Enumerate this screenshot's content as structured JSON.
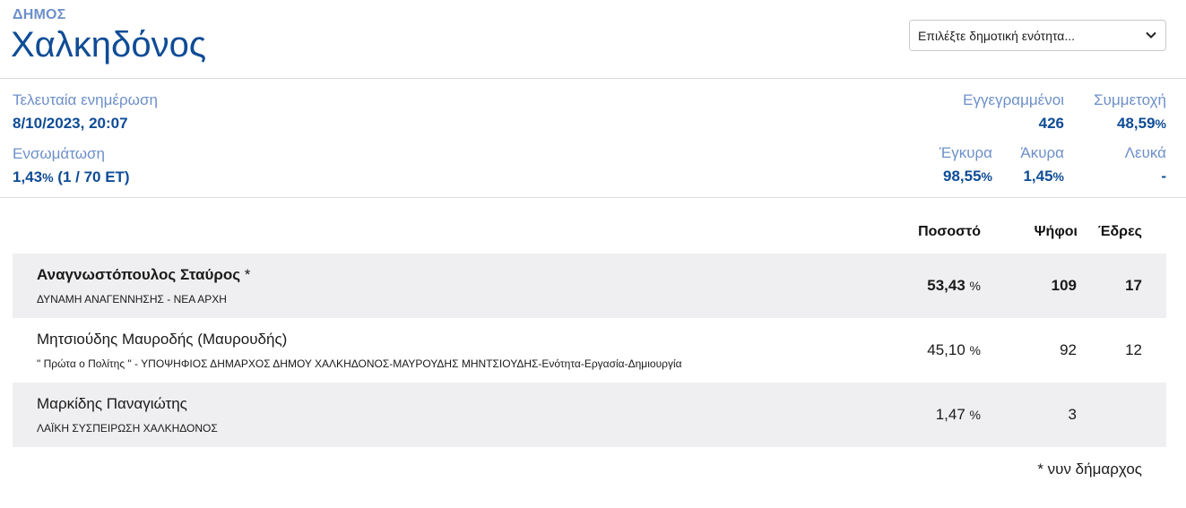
{
  "header": {
    "kind": "ΔΗΜΟΣ",
    "name": "Χαλκηδόνος",
    "select_placeholder": "Επιλέξτε δημοτική ενότητα..."
  },
  "stats": {
    "last_update_label": "Τελευταία ενημέρωση",
    "last_update_value": "8/10/2023, 20:07",
    "integration_label": "Ενσωμάτωση",
    "integration_pct": "1,43",
    "integration_pct_unit": "%",
    "integration_detail": "(1 / 70 ΕΤ)",
    "registered_label": "Εγγεγραμμένοι",
    "registered_value": "426",
    "turnout_label": "Συμμετοχή",
    "turnout_value": "48,59",
    "turnout_unit": "%",
    "valid_label": "Έγκυρα",
    "valid_value": "98,55",
    "valid_unit": "%",
    "invalid_label": "Άκυρα",
    "invalid_value": "1,45",
    "invalid_unit": "%",
    "blank_label": "Λευκά",
    "blank_value": "-"
  },
  "table": {
    "headers": {
      "percent": "Ποσοστό",
      "votes": "Ψήφοι",
      "seats": "Έδρες"
    },
    "rows": [
      {
        "candidate": "Αναγνωστόπουλος Σταύρος",
        "marker": " *",
        "party": "ΔΥΝΑΜΗ ΑΝΑΓΕΝΝΗΣΗΣ - ΝΕΑ ΑΡΧΗ",
        "percent": "53,43",
        "percent_unit": "%",
        "votes": "109",
        "seats": "17"
      },
      {
        "candidate": "Μητσιούδης Μαυροδής (Μαυρουδής)",
        "marker": "",
        "party": "\" Πρώτα ο Πολίτης \" - ΥΠΟΨΗΦΙΟΣ ΔΗΜΑΡΧΟΣ ΔΗΜΟΥ ΧΑΛΚΗΔΟΝΟΣ-ΜΑΥΡΟΥΔΗΣ ΜΗΝΤΣΙΟΥΔΗΣ-Ενότητα-Εργασία-Δημιουργία",
        "percent": "45,10",
        "percent_unit": "%",
        "votes": "92",
        "seats": "12"
      },
      {
        "candidate": "Μαρκίδης Παναγιώτης",
        "marker": "",
        "party": "ΛΑΪΚΗ ΣΥΣΠΕΙΡΩΣΗ ΧΑΛΚΗΔΟΝΟΣ",
        "percent": "1,47",
        "percent_unit": "%",
        "votes": "3",
        "seats": ""
      }
    ],
    "footnote": "* νυν δήμαρχος"
  },
  "colors": {
    "accent": "#0f4c96",
    "label": "#6d8fc9",
    "row_shade": "#efeff1"
  }
}
